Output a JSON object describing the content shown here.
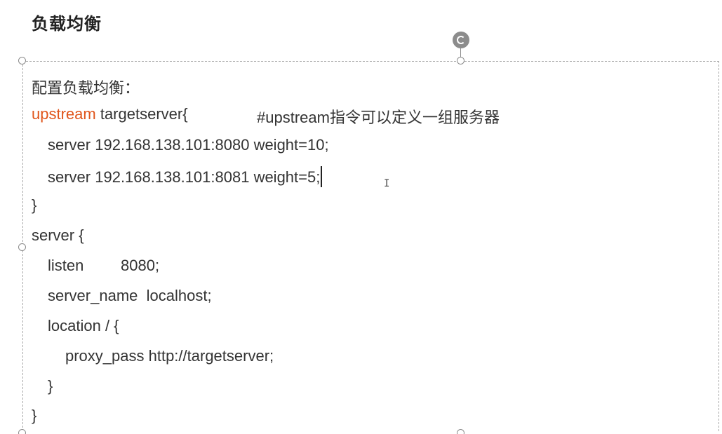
{
  "heading": "负载均衡",
  "content": {
    "intro": "配置负载均衡：",
    "upstream_keyword": "upstream",
    "upstream_rest": " targetserver{",
    "upstream_comment": "#upstream指令可以定义一组服务器",
    "server1": "server 192.168.138.101:8080 weight=10;",
    "server2": "server 192.168.138.101:8081 weight=5;",
    "close1": "}",
    "server_open": "server {",
    "listen_kw": "listen",
    "listen_val": "8080;",
    "server_name": "server_name  localhost;",
    "location": "location / {",
    "proxy_pass": "proxy_pass http://targetserver;",
    "close2": "}",
    "close3": "}"
  },
  "icons": {
    "rotate": "rotate-handle-icon",
    "cursor": "text-cursor-icon",
    "ibeam": "i-beam-pointer-icon"
  },
  "colors": {
    "keyword": "#e0551b",
    "text": "#333333",
    "handle": "#8c8c8c"
  }
}
